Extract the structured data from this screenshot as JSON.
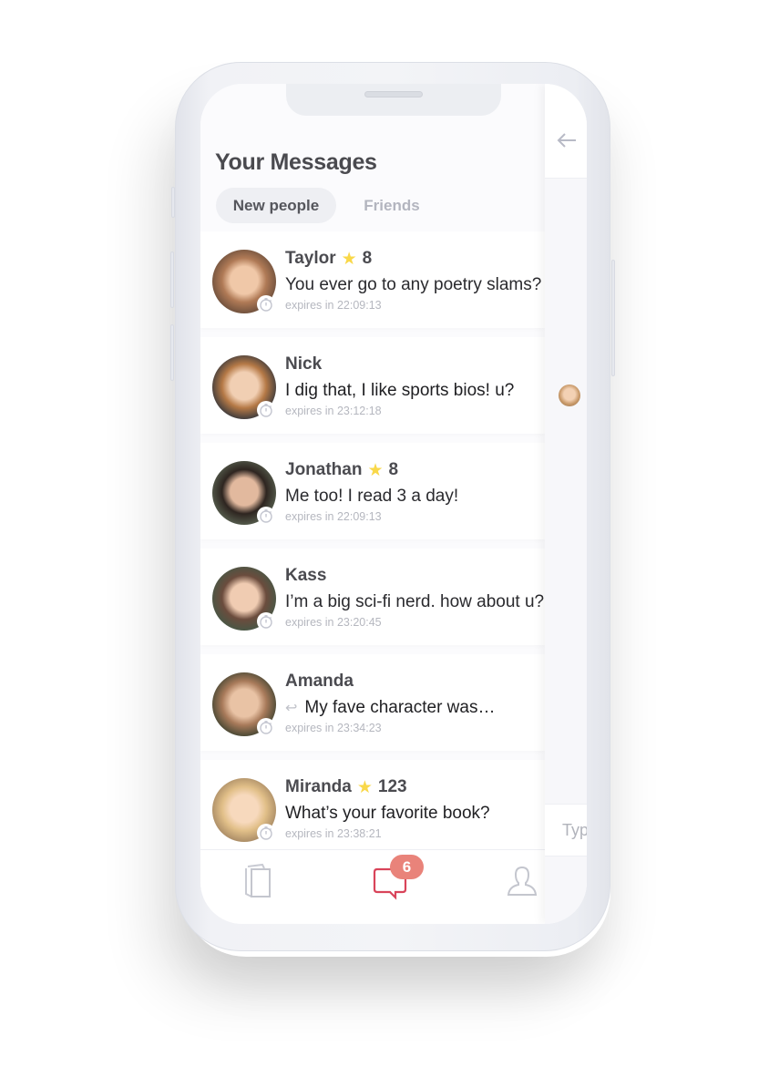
{
  "header": {
    "title": "Your Messages"
  },
  "tabs": [
    {
      "label": "New people",
      "active": true
    },
    {
      "label": "Friends",
      "active": false
    }
  ],
  "conversations": [
    {
      "name": "Taylor",
      "stars": "8",
      "message": "You ever go to any poetry slams?",
      "expires": "expires in 22:09:13",
      "reply": false,
      "avatar_colors": [
        "#f0c8a8",
        "#b07a56",
        "#5d4536"
      ]
    },
    {
      "name": "Nick",
      "stars": null,
      "message": "I dig that, I like sports bios!  u?",
      "expires": "expires in 23:12:18",
      "reply": false,
      "avatar_colors": [
        "#f1cfb3",
        "#b57946",
        "#1d2a3a"
      ]
    },
    {
      "name": "Jonathan",
      "stars": "8",
      "message": "Me too!  I read 3 a day!",
      "expires": "expires in 22:09:13",
      "reply": false,
      "avatar_colors": [
        "#e2b99e",
        "#2e2520",
        "#5f6a58"
      ]
    },
    {
      "name": "Kass",
      "stars": null,
      "message": "I’m a big sci-fi nerd. how about u?",
      "expires": "expires in 23:20:45",
      "reply": false,
      "avatar_colors": [
        "#f0ccb2",
        "#6b4c3d",
        "#3f5a48"
      ]
    },
    {
      "name": "Amanda",
      "stars": null,
      "message": "My fave character was…",
      "expires": "expires in 23:34:23",
      "reply": true,
      "avatar_colors": [
        "#e9c3a5",
        "#a87a5a",
        "#2e3a2a"
      ]
    },
    {
      "name": "Miranda",
      "stars": "123",
      "message": "What’s your favorite book?",
      "expires": "expires in 23:38:21",
      "reply": false,
      "avatar_colors": [
        "#f7d9bd",
        "#e1bf88",
        "#9a7d5c"
      ]
    }
  ],
  "bottom_nav": {
    "items": [
      {
        "icon": "cards-icon",
        "active": false
      },
      {
        "icon": "chat-bubbles-icon",
        "active": true,
        "badge": "6"
      },
      {
        "icon": "profile-icon",
        "active": false
      }
    ]
  },
  "chat_panel": {
    "back_icon": "arrow-left-icon",
    "input_placeholder": "Type"
  },
  "colors": {
    "accent": "#e9837a",
    "chat_icon": "#d9445a",
    "star": "#f9d849",
    "muted": "#b5b7bf"
  }
}
